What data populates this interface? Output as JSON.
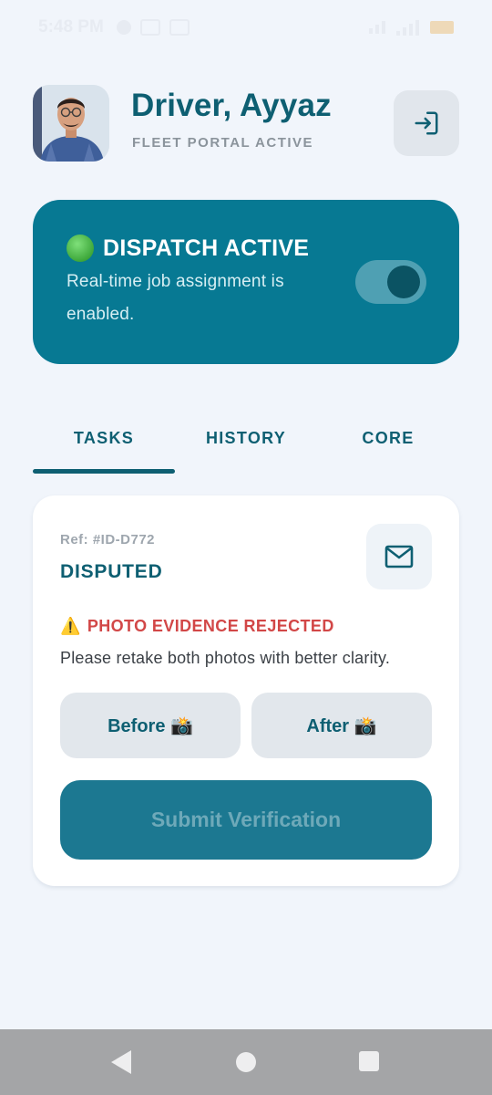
{
  "status_bar": {
    "time": "5:48 PM"
  },
  "header": {
    "driver_name": "Driver, Ayyaz",
    "portal_status": "FLEET PORTAL ACTIVE",
    "logout_icon": "logout-icon"
  },
  "dispatch": {
    "title": "DISPATCH ACTIVE",
    "description": "Real-time job assignment is enabled.",
    "toggle_on": true,
    "accent_color": "#077993"
  },
  "tabs": [
    {
      "label": "TASKS",
      "active": true
    },
    {
      "label": "HISTORY",
      "active": false
    },
    {
      "label": "CORE",
      "active": false
    }
  ],
  "task": {
    "ref": "Ref: #ID-D772",
    "status": "DISPUTED",
    "warning_icon": "⚠️",
    "warning": "PHOTO EVIDENCE REJECTED",
    "note": "Please retake both photos with better clarity.",
    "before_label": "Before 📸",
    "after_label": "After 📸",
    "submit_label": "Submit Verification",
    "warning_color": "#d24747"
  },
  "colors": {
    "primary": "#0e5f72",
    "background": "#f1f5fb"
  }
}
